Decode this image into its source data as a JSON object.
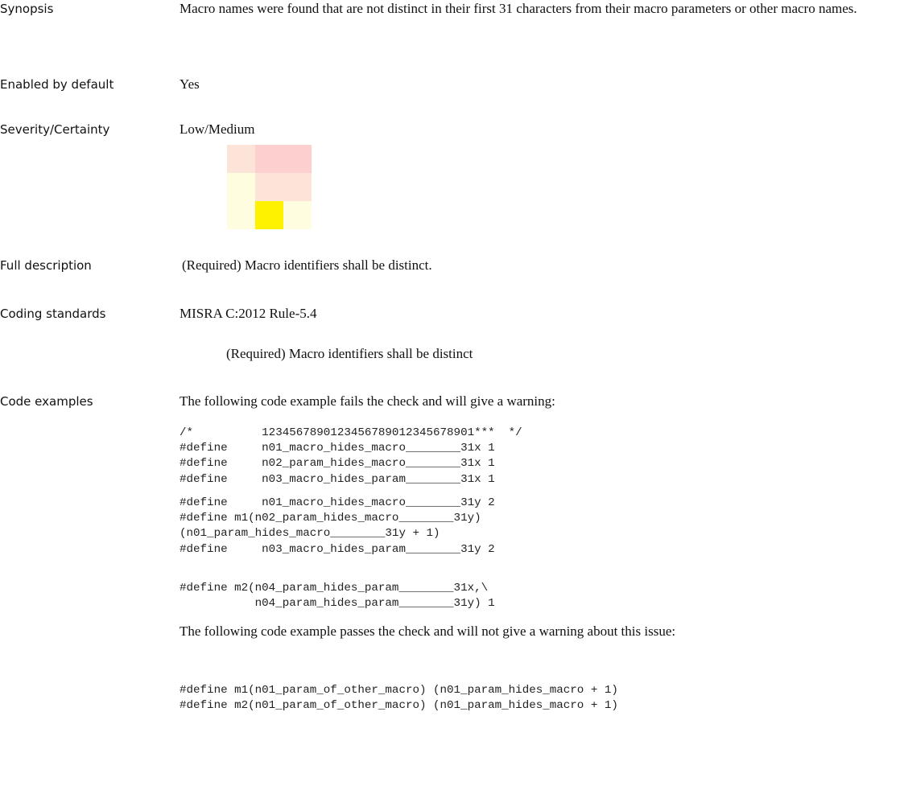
{
  "rows": {
    "synopsis": {
      "label": "Synopsis",
      "text": "Macro names were found that are not distinct in their first 31 characters from their macro parameters or other macro names."
    },
    "enabled": {
      "label": "Enabled by default",
      "text": "Yes"
    },
    "severity": {
      "label": "Severity/Certainty",
      "text": "Low/Medium",
      "matrix": {
        "selected_cell": "row 3, column 2",
        "colors": {
          "light_peach": "#fde4d8",
          "pink": "#fdd0d0",
          "light_yellow": "#fefde0",
          "selected_yellow": "#fff200"
        }
      }
    },
    "full_description": {
      "label": "Full description",
      "text": "(Required) Macro identifiers shall be distinct."
    },
    "coding_standards": {
      "label": "Coding standards",
      "standard": "MISRA C:2012 Rule-5.4",
      "standard_description": "(Required) Macro identifiers shall be distinct"
    },
    "code_examples": {
      "label": "Code examples",
      "fail_intro": "The following code example fails the check and will give a warning:",
      "fail_code_1": "/*          1234567890123456789012345678901***  */\n#define     n01_macro_hides_macro________31x 1\n#define     n02_param_hides_macro________31x 1\n#define     n03_macro_hides_param________31x 1",
      "fail_code_2": "#define     n01_macro_hides_macro________31y 2\n#define m1(n02_param_hides_macro________31y)\n(n01_param_hides_macro________31y + 1)\n#define     n03_macro_hides_param________31y 2",
      "fail_code_3": "#define m2(n04_param_hides_param________31x,\\\n           n04_param_hides_param________31y) 1",
      "pass_intro": "The following code example passes the check and will not give a warning about this issue:",
      "pass_code": "#define m1(n01_param_of_other_macro) (n01_param_hides_macro + 1)\n#define m2(n01_param_of_other_macro) (n01_param_hides_macro + 1)"
    }
  }
}
